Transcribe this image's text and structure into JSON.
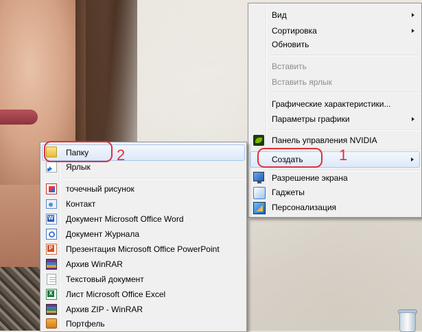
{
  "desktop_menu": {
    "items": [
      {
        "label": "Вид",
        "submenu": true,
        "disabled": false
      },
      {
        "label": "Сортировка",
        "submenu": true,
        "disabled": false
      },
      {
        "label": "Обновить",
        "submenu": false,
        "disabled": false
      },
      {
        "label": "Вставить",
        "submenu": false,
        "disabled": true
      },
      {
        "label": "Вставить ярлык",
        "submenu": false,
        "disabled": true
      },
      {
        "label": "Графические характеристики...",
        "submenu": false,
        "disabled": false
      },
      {
        "label": "Параметры графики",
        "submenu": true,
        "disabled": false
      },
      {
        "label": "Панель управления NVIDIA",
        "icon": "nvidia-icon",
        "submenu": false,
        "disabled": false
      },
      {
        "label": "Создать",
        "submenu": true,
        "highlighted": true,
        "disabled": false
      },
      {
        "label": "Разрешение экрана",
        "icon": "monitor-icon",
        "submenu": false,
        "disabled": false
      },
      {
        "label": "Гаджеты",
        "icon": "gadgets-icon",
        "submenu": false,
        "disabled": false
      },
      {
        "label": "Персонализация",
        "icon": "personalization-icon",
        "submenu": false,
        "disabled": false
      }
    ]
  },
  "create_submenu": {
    "items": [
      {
        "label": "Папку",
        "icon": "folder-icon",
        "highlighted": true
      },
      {
        "label": "Ярлык",
        "icon": "shortcut-icon"
      },
      {
        "label": "точечный рисунок",
        "icon": "bitmap-icon"
      },
      {
        "label": "Контакт",
        "icon": "contact-icon"
      },
      {
        "label": "Документ Microsoft Office Word",
        "icon": "word-icon"
      },
      {
        "label": "Документ Журнала",
        "icon": "journal-icon"
      },
      {
        "label": "Презентация Microsoft Office PowerPoint",
        "icon": "powerpoint-icon"
      },
      {
        "label": "Архив WinRAR",
        "icon": "winrar-icon"
      },
      {
        "label": "Текстовый документ",
        "icon": "text-document-icon"
      },
      {
        "label": "Лист Microsoft Office Excel",
        "icon": "excel-icon"
      },
      {
        "label": "Архив ZIP - WinRAR",
        "icon": "zip-icon"
      },
      {
        "label": "Портфель",
        "icon": "briefcase-icon"
      }
    ]
  },
  "annotations": {
    "step1": "1",
    "step2": "2"
  },
  "colors": {
    "annotation": "#e0303a",
    "highlight_border": "#a8c7ee",
    "menu_bg": "#f0f0f0"
  }
}
